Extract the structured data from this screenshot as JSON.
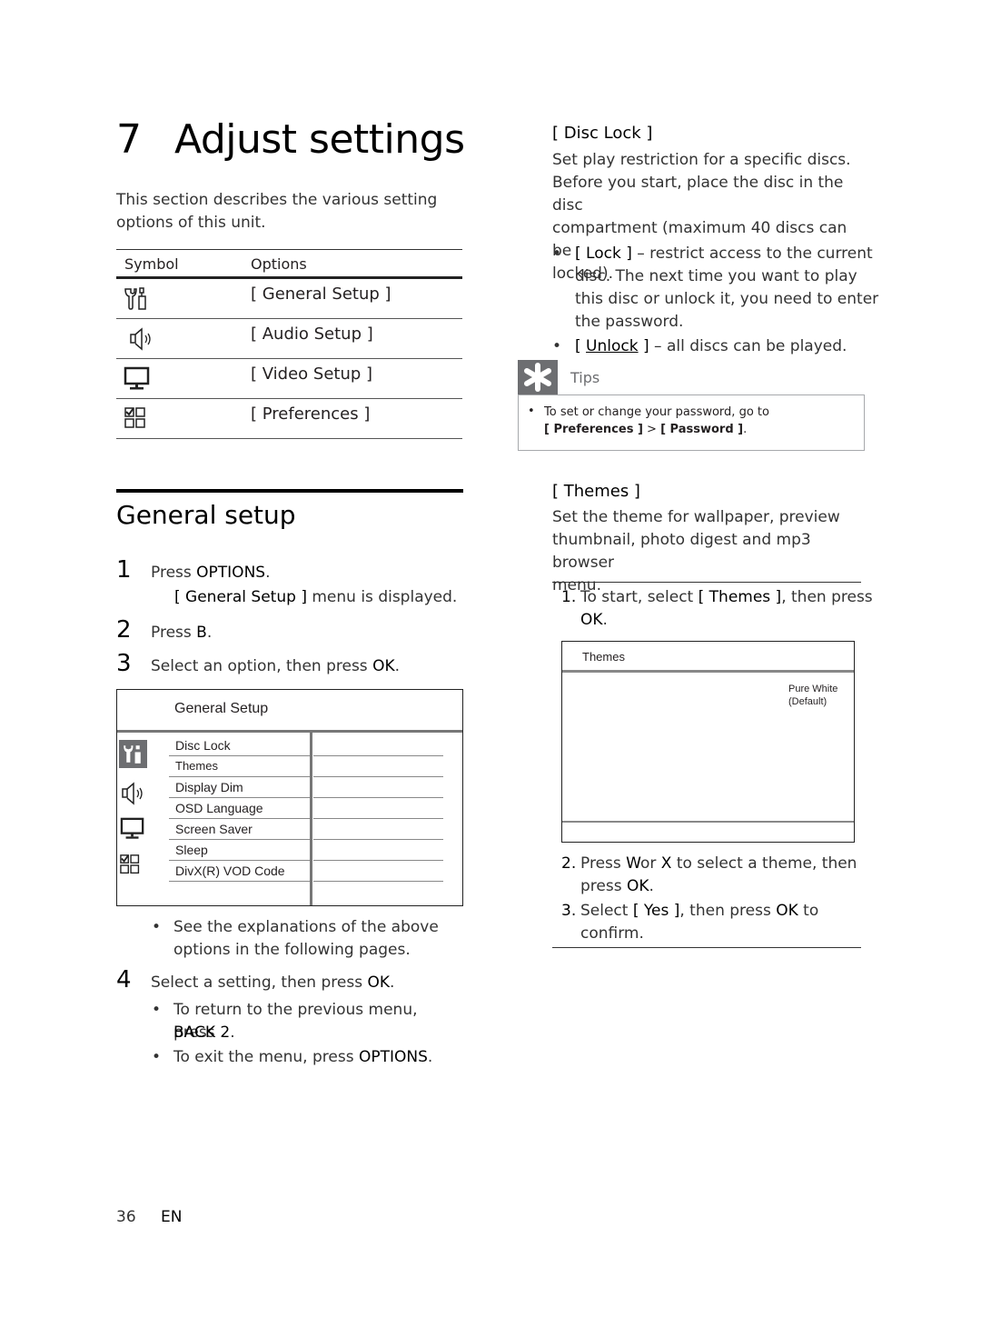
{
  "chapter": {
    "number": "7",
    "title": "Adjust settings"
  },
  "intro": "This section describes the various setting options of this unit.",
  "symbol_table": {
    "headers": [
      "Symbol",
      "Options"
    ],
    "rows": [
      {
        "icon": "general-setup-icon",
        "option": "[ General Setup ]"
      },
      {
        "icon": "audio-setup-icon",
        "option": "[ Audio Setup ]"
      },
      {
        "icon": "video-setup-icon",
        "option": "[ Video Setup ]"
      },
      {
        "icon": "preferences-icon",
        "option": "[ Preferences ]"
      }
    ]
  },
  "general_setup": {
    "heading": "General setup",
    "steps": [
      {
        "n": "1",
        "pre": "Press ",
        "key": "OPTIONS",
        "post": ".",
        "sub_bold": "[ General Setup ]",
        "sub_rest": " menu is displayed."
      },
      {
        "n": "2",
        "pre": "Press ",
        "key": "B",
        "post": "."
      },
      {
        "n": "3",
        "pre": "Select an option, then press ",
        "key": "OK",
        "post": "."
      }
    ],
    "menu": {
      "title": "General Setup",
      "items": [
        "Disc Lock",
        "Themes",
        "Display Dim",
        "OSD Language",
        "Screen Saver",
        "Sleep",
        "DivX(R) VOD Code"
      ]
    },
    "note": [
      "See the explanations of the above",
      "options in the following pages."
    ],
    "step4": {
      "n": "4",
      "pre": "Select a setting, then press ",
      "key": "OK",
      "post": "."
    },
    "step4_bullets": [
      {
        "line1": "To return to the previous menu, press",
        "line2_key": "BACK  2",
        "line2_post": "."
      },
      {
        "pre": "To exit the menu, press ",
        "key": "OPTIONS",
        "post": "."
      }
    ]
  },
  "disc_lock": {
    "heading": "[ Disc Lock ]",
    "desc": [
      "Set play restriction for a specific discs.",
      "Before you start, place the disc in the disc",
      "compartment (maximum 40 discs can be",
      "locked)."
    ],
    "lock": {
      "label": "[ Lock ]",
      "text": [
        " – restrict access to the current",
        "disc.  The next time you want to play",
        "this disc or unlock it, you need to enter",
        "the password."
      ]
    },
    "unlock": {
      "label_open": "[ ",
      "label": "Unlock",
      "label_close": " ]",
      "text": " – all discs can be played."
    }
  },
  "tips": {
    "label": "Tips",
    "text": "To set or change your password, go to",
    "path_a": "[ Preferences ]",
    "sep": " > ",
    "path_b": "[ Password ]",
    "end": "."
  },
  "themes": {
    "heading": "[ Themes ]",
    "desc": [
      "Set the theme for wallpaper, preview",
      "thumbnail, photo digest and mp3 browser",
      "menu."
    ],
    "step1": {
      "n": "1.",
      "pre": "To start, select ",
      "bold": "[ Themes ]",
      "post": ", then press",
      "line2": "OK",
      "line2_post": "."
    },
    "box": {
      "title": "Themes",
      "option": "Pure White",
      "option_note": "(Default)"
    },
    "step2": {
      "n": "2.",
      "pre": "Press ",
      "k1": "W",
      "mid": "or ",
      "k2": "X",
      "post": " to select a theme, then",
      "line2_pre": "press ",
      "line2_key": "OK",
      "line2_post": "."
    },
    "step3": {
      "n": "3.",
      "pre": "Select ",
      "bold": "[ Yes ]",
      "mid": ", then press ",
      "key": "OK",
      "post": " to",
      "line2": "confirm."
    }
  },
  "footer": {
    "page": "36",
    "lang": "EN"
  }
}
